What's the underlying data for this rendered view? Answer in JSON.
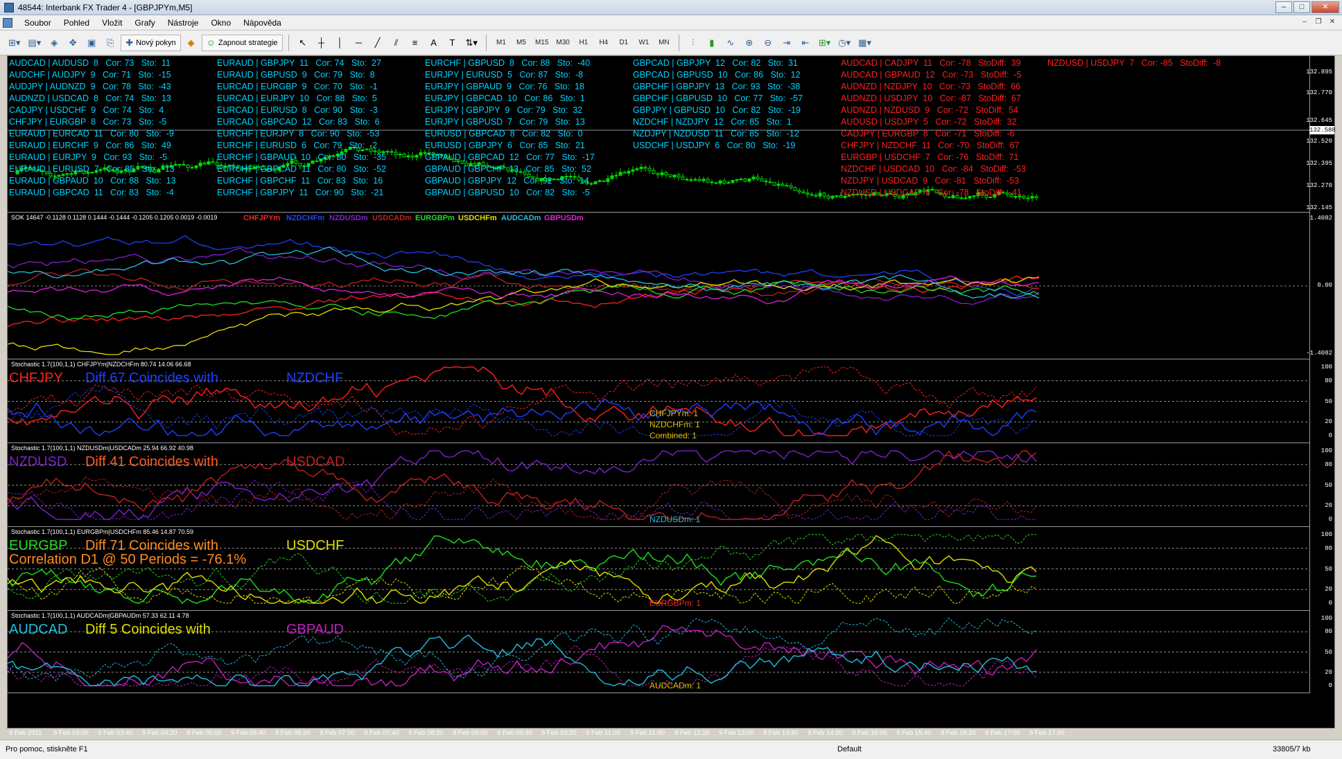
{
  "window": {
    "title": "48544: Interbank FX Trader 4 - [GBPJPYm,M5]"
  },
  "menu": [
    "Soubor",
    "Pohled",
    "Vložit",
    "Grafy",
    "Nástroje",
    "Okno",
    "Nápověda"
  ],
  "toolbar": {
    "new_order": "Nový pokyn",
    "strategy": "Zapnout strategie",
    "timeframes": [
      "M1",
      "M5",
      "M15",
      "M30",
      "H1",
      "H4",
      "D1",
      "W1",
      "MN"
    ]
  },
  "main_pane": {
    "price_tag": "132.588",
    "price_levels": [
      "132.895",
      "132.770",
      "132.645",
      "132.520",
      "132.395",
      "132.270",
      "132.145"
    ],
    "columns": [
      {
        "color": "#00d4ff",
        "rows": [
          "AUDCAD | AUDUSD  8   Cor: 73   Sto:  11",
          "AUDCHF | AUDJPY  9   Cor: 71   Sto:  -15",
          "AUDJPY | AUDNZD  9   Cor: 78   Sto:  -43",
          "AUDNZD | USDCAD  8   Cor: 74   Sto:  13",
          "CADJPY | USDCHF  9   Cor: 74   Sto:  4",
          "CHFJPY | EURGBP  8   Cor: 73   Sto:  -5",
          "EURAUD | EURCAD  11   Cor: 80   Sto:  -9",
          "EURAUD | EURCHF  9   Cor: 86   Sto:  49",
          "EURAUD | EURJPY  9   Cor: 93   Sto:  -5",
          "EURAUD | EURUSD  7   Cor: 85   Sto:  -13",
          "EURAUD | GBPAUD  10   Cor: 88   Sto:  13",
          "EURAUD | GBPCAD  11   Cor: 83   Sto:  -4"
        ]
      },
      {
        "color": "#00d4ff",
        "rows": [
          "EURAUD | GBPJPY  11   Cor: 74   Sto:  27",
          "EURAUD | GBPUSD  9   Cor: 79   Sto:  8",
          "EURCAD | EURGBP  9   Cor: 70   Sto:  -1",
          "EURCAD | EURJPY  10   Cor: 88   Sto:  5",
          "EURCAD | EURUSD  8   Cor: 90   Sto:  -3",
          "EURCAD | GBPCAD  12   Cor: 83   Sto:  6",
          "EURCHF | EURJPY  8   Cor: 90   Sto:  -53",
          "EURCHF | EURUSD  6   Cor: 79   Sto:  -2",
          "EURCHF | GBPAUD  10   Cor: 80   Sto:  -35",
          "EURCHF | GBPCAD  11   Cor: 80   Sto:  -52",
          "EURCHF | GBPCHF  11   Cor: 83   Sto:  16",
          "EURCHF | GBPJPY  11   Cor: 90   Sto:  -21"
        ]
      },
      {
        "color": "#00d4ff",
        "rows": [
          "EURCHF | GBPUSD  8   Cor: 88   Sto:  -40",
          "EURJPY | EURUSD  5   Cor: 87   Sto:  -8",
          "EURJPY | GBPAUD  9   Cor: 76   Sto:  18",
          "EURJPY | GBPCAD  10   Cor: 86   Sto:  1",
          "EURJPY | GBPJPY  9   Cor: 79   Sto:  32",
          "EURJPY | GBPUSD  7   Cor: 79   Sto:  13",
          "EURUSD | GBPCAD  8   Cor: 82   Sto:  0",
          "EURUSD | GBPJPY  6   Cor: 85   Sto:  21",
          "GBPAUD | GBPCAD  12   Cor: 77   Sto:  -17",
          "GBPAUD | GBPCHF  13   Cor: 85   Sto:  52",
          "GBPAUD | GBPJPY  12   Cor: 92   Sto:  14",
          "GBPAUD | GBPUSD  10   Cor: 82   Sto:  -5"
        ]
      },
      {
        "color": "#00d4ff",
        "rows": [
          "GBPCAD | GBPJPY  12   Cor: 82   Sto:  31",
          "GBPCAD | GBPUSD  10   Cor: 86   Sto:  12",
          "GBPCHF | GBPJPY  13   Cor: 93   Sto:  -38",
          "GBPCHF | GBPUSD  10   Cor: 77   Sto:  -57",
          "GBPJPY | GBPUSD  10   Cor: 82   Sto:  -19",
          "NZDCHF | NZDJPY  12   Cor: 85   Sto:  1",
          "NZDJPY | NZDUSD  11   Cor: 85   Sto:  -12",
          "USDCHF | USDJPY  6   Cor: 80   Sto:  -19"
        ]
      },
      {
        "color": "#ff2020",
        "rows": [
          "AUDCAD | CADJPY  11   Cor: -78   StoDiff:  39",
          "AUDCAD | GBPAUD  12   Cor: -73   StoDiff:  -5",
          "AUDNZD | NZDJPY  10   Cor: -73   StoDiff:  66",
          "AUDNZD | USDJPY  10   Cor: -87   StoDiff:  67",
          "AUDNZD | NZDUSD  9   Cor: -72   StoDiff:  54",
          "AUDUSD | USDJPY  5   Cor: -72   StoDiff:  32",
          "CADJPY | EURGBP  8   Cor: -71   StoDiff:  -6",
          "CHFJPY | NZDCHF  11   Cor: -70   StoDiff:  67",
          "EURGBP | USDCHF  7   Cor: -76   StoDiff:  71",
          "NZDCHF | USDCAD  10   Cor: -84   StoDiff:  -53",
          "NZDJPY | USDCAD  9   Cor: -81   StoDiff:  -53",
          "NZDUSD | USDCAD  8   Cor: -78   StoDiff:  -41"
        ]
      },
      {
        "color": "#ff2020",
        "rows": [
          "NZDUSD | USDJPY  7   Cor: -85   StoDiff:  -8"
        ]
      }
    ]
  },
  "sok_pane": {
    "title": "SOK 14647 -0.1128 0.1128 0.1444 -0.1444 -0.1205 0.1205 0.0019 -0.0019",
    "legend": [
      {
        "name": "CHFJPYm",
        "color": "#ff2020"
      },
      {
        "name": "NZDCHFm",
        "color": "#2040ff"
      },
      {
        "name": "NZDUSDm",
        "color": "#8020d0"
      },
      {
        "name": "USDCADm",
        "color": "#c02020"
      },
      {
        "name": "EURGBPm",
        "color": "#20e020"
      },
      {
        "name": "USDCHFm",
        "color": "#e0e000"
      },
      {
        "name": "AUDCADm",
        "color": "#20c0e0"
      },
      {
        "name": "GBPUSDm",
        "color": "#e020e0"
      }
    ],
    "levels": [
      "1.4082",
      "0.00",
      "-1.4082"
    ]
  },
  "stoch_panes": [
    {
      "title": "Stochastic 1.7(100,1,1) CHFJPYm|NZDCHFm 80.74 14.06 66.68",
      "pair1": "CHFJPY",
      "pair1_color": "#ff2020",
      "mid": "Diff 67 Coincides with",
      "mid_color": "#2040ff",
      "pair2": "NZDCHF",
      "pair2_color": "#2040ff",
      "notes": [
        "CHFJPYm: 1",
        "NZDCHFm: 1",
        "Combined: 1"
      ],
      "note_color": "#e0c000"
    },
    {
      "title": "Stochastic 1.7(100,1,1) NZDUSDm|USDCADm 25.94 66.92 40.98",
      "pair1": "NZDUSD",
      "pair1_color": "#8020d0",
      "mid": "Diff 41 Coincides with",
      "mid_color": "#ff5a20",
      "pair2": "USDCAD",
      "pair2_color": "#c02020",
      "notes": [
        "NZDUSDm: 1"
      ],
      "note_color": "#20c0e0"
    },
    {
      "title": "Stochastic 1.7(100,1,1) EURGBPm|USDCHFm 85.46 14.87 70.59",
      "pair1": "EURGBP",
      "pair1_color": "#20e020",
      "mid": "Diff 71 Coincides with",
      "mid_color": "#ff8c20",
      "pair2": "USDCHF",
      "pair2_color": "#e0e000",
      "extra": "Correlation D1 @ 50 Periods = -76.1%",
      "extra_color": "#ff8c20",
      "notes": [
        "EURGBPm: 1"
      ],
      "note_color": "#ff2020"
    },
    {
      "title": "Stochastic 1.7(100,1,1) AUDCADm|GBPAUDm 57.33 62.11 4.78",
      "pair1": "AUDCAD",
      "pair1_color": "#20c0e0",
      "mid": "Diff 5 Coincides with",
      "mid_color": "#e0e000",
      "pair2": "GBPAUD",
      "pair2_color": "#c020c0",
      "notes": [
        "AUDCADm: 1"
      ],
      "note_color": "#e0c000"
    }
  ],
  "stoch_levels": [
    "100",
    "80",
    "50",
    "20",
    "0"
  ],
  "xaxis": [
    "9 Feb 2011",
    "9 Feb 03:00",
    "9 Feb 03:40",
    "9 Feb 04:20",
    "9 Feb 05:00",
    "9 Feb 05:40",
    "9 Feb 06:20",
    "9 Feb 07:00",
    "9 Feb 07:40",
    "9 Feb 08:20",
    "9 Feb 09:00",
    "9 Feb 09:40",
    "9 Feb 10:20",
    "9 Feb 11:00",
    "9 Feb 11:40",
    "9 Feb 12:20",
    "9 Feb 13:00",
    "9 Feb 13:40",
    "9 Feb 14:20",
    "9 Feb 15:00",
    "9 Feb 15:40",
    "9 Feb 16:20",
    "9 Feb 17:00",
    "9 Feb 17:40"
  ],
  "status": {
    "help": "Pro pomoc, stiskněte F1",
    "profile": "Default",
    "traffic": "33805/7 kb"
  }
}
